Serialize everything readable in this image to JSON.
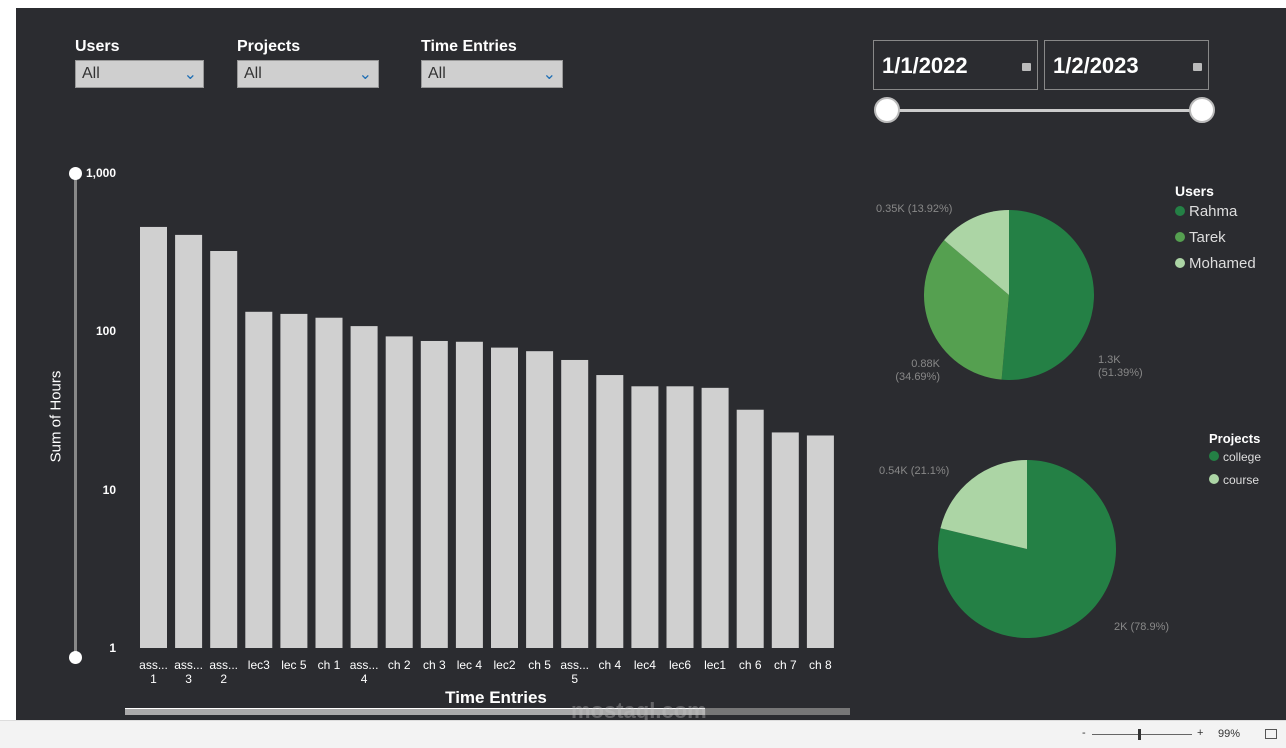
{
  "filters": [
    {
      "title": "Users",
      "value": "All"
    },
    {
      "title": "Projects",
      "value": "All"
    },
    {
      "title": "Time Entries",
      "value": "All"
    }
  ],
  "date_range": {
    "start": "1/1/2022",
    "end": "1/2/2023"
  },
  "colors": {
    "bar": "#d0d0d0",
    "dark_green": "#248045",
    "mid_green": "#55a050",
    "light_green": "#acd5a5",
    "background": "#2b2c30"
  },
  "chart_data": [
    {
      "type": "bar",
      "xlabel": "Time Entries",
      "ylabel": "Sum of Hours",
      "yscale": "log",
      "ylim": [
        1,
        1000
      ],
      "yticks": [
        "1",
        "10",
        "100",
        "1,000"
      ],
      "categories": [
        "ass... 1",
        "ass... 3",
        "ass... 2",
        "lec3",
        "lec 5",
        "ch 1",
        "ass... 4",
        "ch 2",
        "ch 3",
        "lec 4",
        "lec2",
        "ch 5",
        "ass... 5",
        "ch 4",
        "lec4",
        "lec6",
        "lec1",
        "ch 6",
        "ch 7",
        "ch 8"
      ],
      "values": [
        457,
        407,
        322,
        133,
        129,
        122,
        108,
        93,
        87,
        86,
        79,
        75,
        66,
        53,
        45,
        45,
        44,
        32,
        23,
        22
      ]
    },
    {
      "type": "pie",
      "legend_title": "Users",
      "labels": [
        "Rahma",
        "Tarek",
        "Mohamed"
      ],
      "values": [
        1300,
        880,
        350
      ],
      "percents": [
        51.39,
        34.69,
        13.92
      ],
      "data_labels": [
        "1.3K (51.39%)",
        "0.88K (34.69%)",
        "0.35K (13.92%)"
      ]
    },
    {
      "type": "pie",
      "legend_title": "Projects",
      "labels": [
        "college",
        "course"
      ],
      "values": [
        2000,
        540
      ],
      "percents": [
        78.9,
        21.1
      ],
      "data_labels": [
        "2K (78.9%)",
        "0.54K (21.1%)"
      ]
    }
  ],
  "status": {
    "zoom": "99%",
    "minus": "-",
    "plus": "+"
  },
  "watermark": "mostaql.com"
}
